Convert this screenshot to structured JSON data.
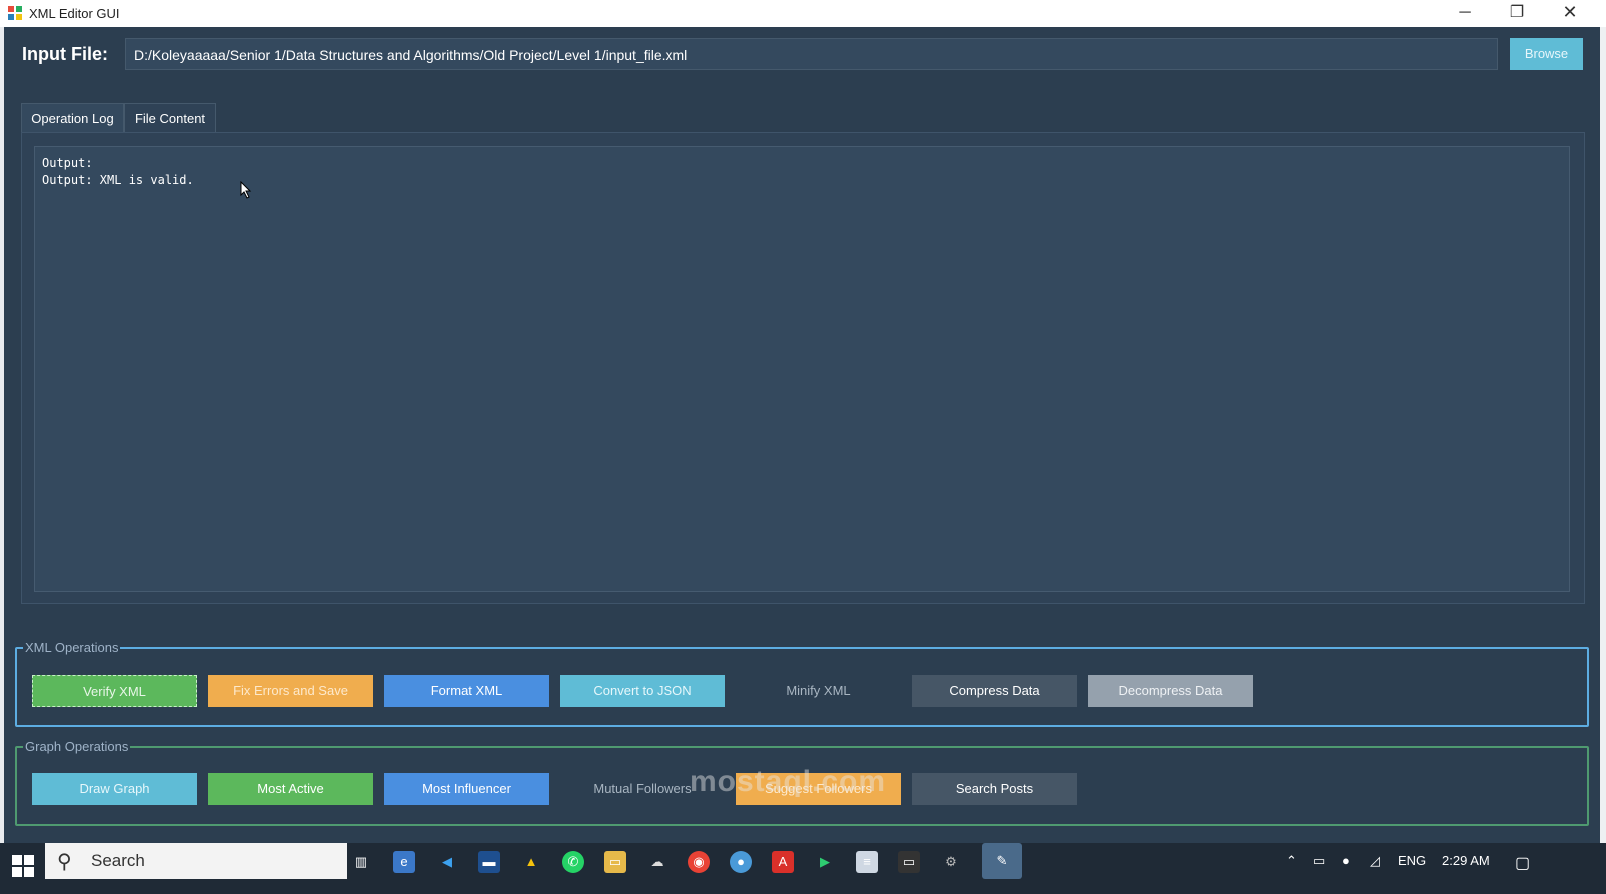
{
  "window": {
    "title": "XML Editor GUI",
    "minimize": "─",
    "maximize": "❐",
    "close": "✕"
  },
  "input": {
    "label": "Input File:",
    "path": "D:/Koleyaaaaa/Senior 1/Data Structures and Algorithms/Old Project/Level 1/input_file.xml",
    "browse_label": "Browse"
  },
  "tabs": [
    {
      "label": "Operation Log",
      "active": true
    },
    {
      "label": "File Content",
      "active": false
    }
  ],
  "log": {
    "lines": [
      "Output:",
      "Output: XML is valid."
    ]
  },
  "xml_operations": {
    "title": "XML Operations",
    "buttons": [
      {
        "label": "Verify XML",
        "color": "#5cb85c"
      },
      {
        "label": "Fix Errors and Save",
        "color": "#f0ad4e"
      },
      {
        "label": "Format XML",
        "color": "#4a8fe0"
      },
      {
        "label": "Convert to JSON",
        "color": "#5fbcd6"
      },
      {
        "label": "Minify XML",
        "color": "#2c3e50"
      },
      {
        "label": "Compress Data",
        "color": "#465666"
      },
      {
        "label": "Decompress Data",
        "color": "#95a1ad"
      }
    ]
  },
  "graph_operations": {
    "title": "Graph Operations",
    "buttons": [
      {
        "label": "Draw Graph",
        "color": "#5fbcd6"
      },
      {
        "label": "Most Active",
        "color": "#5cb85c"
      },
      {
        "label": "Most Influencer",
        "color": "#4a8fe0"
      },
      {
        "label": "Mutual Followers",
        "color": "#2c3e50"
      },
      {
        "label": "Suggest Followers",
        "color": "#f0ad4e"
      },
      {
        "label": "Search Posts",
        "color": "#465666"
      }
    ]
  },
  "taskbar": {
    "search_placeholder": "Search",
    "tray_language": "ENG",
    "time": "2:29 AM"
  },
  "watermark": "mostaql.com"
}
